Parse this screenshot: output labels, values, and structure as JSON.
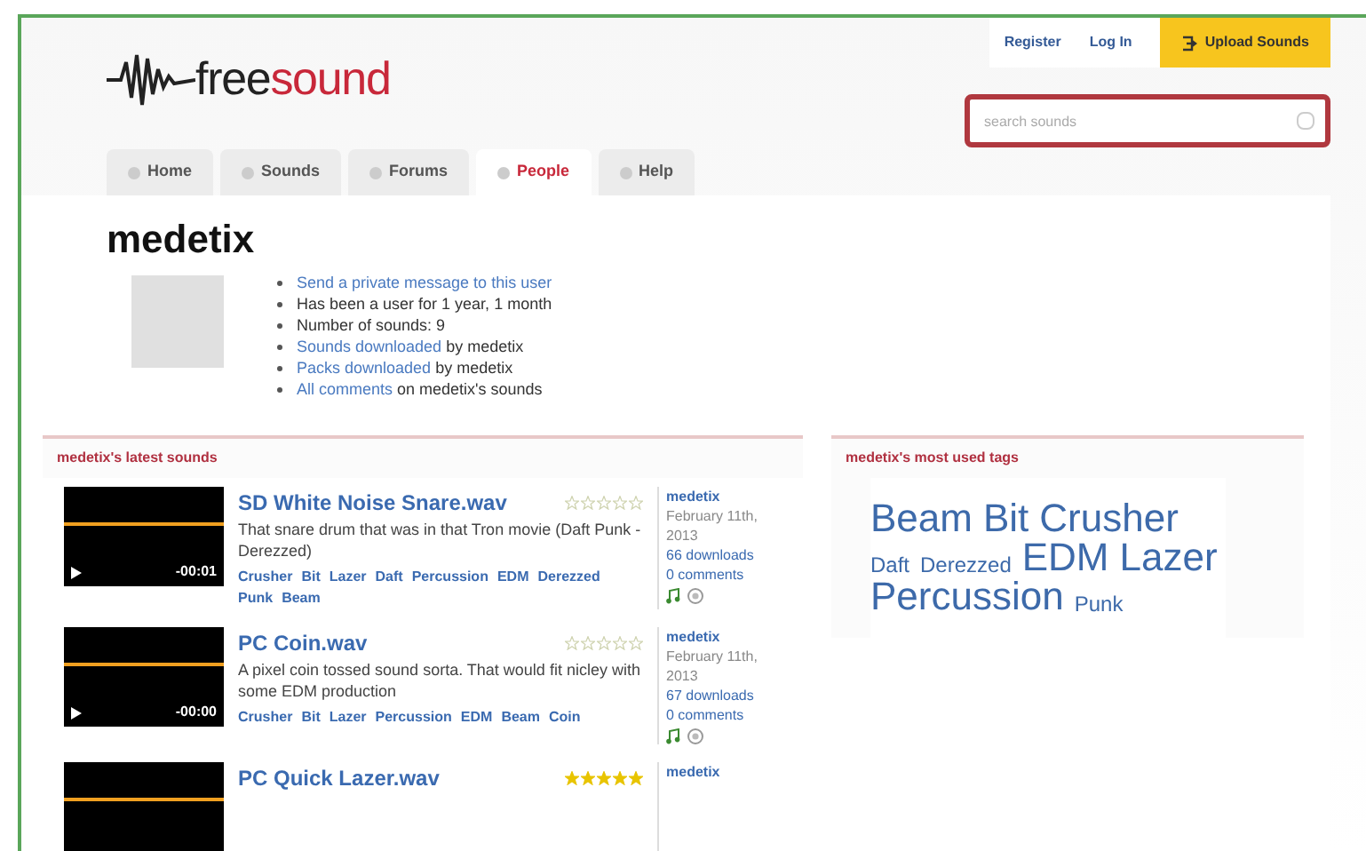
{
  "logo": {
    "part_1": "free",
    "part_2": "sound"
  },
  "top_links": [
    {
      "label": "Register",
      "kind": "link"
    },
    {
      "label": "Log In",
      "kind": "link"
    },
    {
      "label": "Upload Sounds",
      "kind": "upload"
    }
  ],
  "search": {
    "placeholder": "search sounds"
  },
  "tabs": [
    {
      "label": "Home",
      "selected": false
    },
    {
      "label": "Sounds",
      "selected": false
    },
    {
      "label": "Forums",
      "selected": false
    },
    {
      "label": "People",
      "selected": true
    },
    {
      "label": "Help",
      "selected": false
    }
  ],
  "profile": {
    "username": "medetix",
    "facts": [
      {
        "link": "Send a private message to this user"
      },
      {
        "text": "Has been a user for 1 year, 1 month"
      },
      {
        "text": "Number of sounds: 9"
      },
      {
        "link": "Sounds downloaded",
        "text": "by medetix"
      },
      {
        "link": "Packs downloaded",
        "text": "by medetix"
      },
      {
        "link": "All comments",
        "text": "on medetix's sounds"
      }
    ]
  },
  "latest_sounds": {
    "heading": "medetix's latest sounds",
    "sounds": [
      {
        "title": "SD White Noise Snare.wav",
        "stars": 0,
        "time": "-00:01",
        "description": "That snare drum that was in that Tron movie (Daft Punk - Derezzed)",
        "tags": [
          "Crusher",
          "Bit",
          "Lazer",
          "Daft",
          "Percussion",
          "EDM",
          "Derezzed",
          "Punk",
          "Beam"
        ],
        "user": "medetix",
        "date": "February 11th, 2013",
        "downloads": "66 downloads",
        "comments": "0 comments"
      },
      {
        "title": "PC Coin.wav",
        "stars": 0,
        "time": "-00:00",
        "description": "A pixel coin tossed sound sorta. That would fit nicley with some EDM production",
        "tags": [
          "Crusher",
          "Bit",
          "Lazer",
          "Percussion",
          "EDM",
          "Beam",
          "Coin"
        ],
        "user": "medetix",
        "date": "February 11th, 2013",
        "downloads": "67 downloads",
        "comments": "0 comments"
      },
      {
        "title": "PC Quick Lazer.wav",
        "stars": 5,
        "user": "medetix"
      }
    ]
  },
  "tag_cloud": {
    "heading": "medetix's most used tags",
    "tags": [
      {
        "label": "Beam",
        "kind": "large"
      },
      {
        "label": "Bit",
        "kind": "large"
      },
      {
        "label": "Crusher",
        "kind": "large"
      },
      {
        "label": "Daft",
        "kind": "small"
      },
      {
        "label": "Derezzed",
        "kind": "small"
      },
      {
        "label": "EDM",
        "kind": "large"
      },
      {
        "label": "Lazer",
        "kind": "large"
      },
      {
        "label": "Percussion",
        "kind": "large"
      },
      {
        "label": "Punk",
        "kind": "small"
      }
    ]
  }
}
